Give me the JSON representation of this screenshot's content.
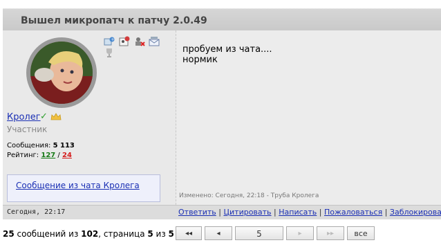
{
  "post": {
    "title": "Вышел микропатч к патчу 2.0.49",
    "author": {
      "name": "Кролег",
      "role": "Участник",
      "messages_label": "Сообщения:",
      "messages_count": "5 113",
      "rating_label": "Рейтинг:",
      "rating_pos": "127",
      "rating_sep": "/",
      "rating_neg": "24",
      "chat_link": "Сообщение из чата Кролега",
      "check_glyph": "✓"
    },
    "toolbar_icons": [
      "add-to-favorites-icon",
      "profile-card-icon",
      "ignore-user-icon",
      "send-message-icon",
      "trophy-icon"
    ],
    "message_lines": [
      "пробуем из чата....",
      "нормик"
    ],
    "edited_note": "Изменено: Сегодня, 22:18 - Труба Кролега",
    "date": "Сегодня, 22:17",
    "actions": [
      "Ответить",
      "Цитировать",
      "Написать",
      "Пожаловаться",
      "Заблокировать"
    ]
  },
  "pagination": {
    "summary_prefix": "25",
    "summary_middle1": " сообщений из ",
    "total": "102",
    "summary_middle2": ", страница ",
    "current": "5",
    "summary_middle3": " из ",
    "pages": "5",
    "first": "◂◂",
    "prev": "◂",
    "page_value": "5",
    "next": "▸",
    "last": "▸▸",
    "all": "все"
  },
  "colors": {
    "link": "#1a2fb4",
    "rating_pos": "#167a16",
    "rating_neg": "#d41c1c",
    "header_bg": "#cfcfcf"
  }
}
